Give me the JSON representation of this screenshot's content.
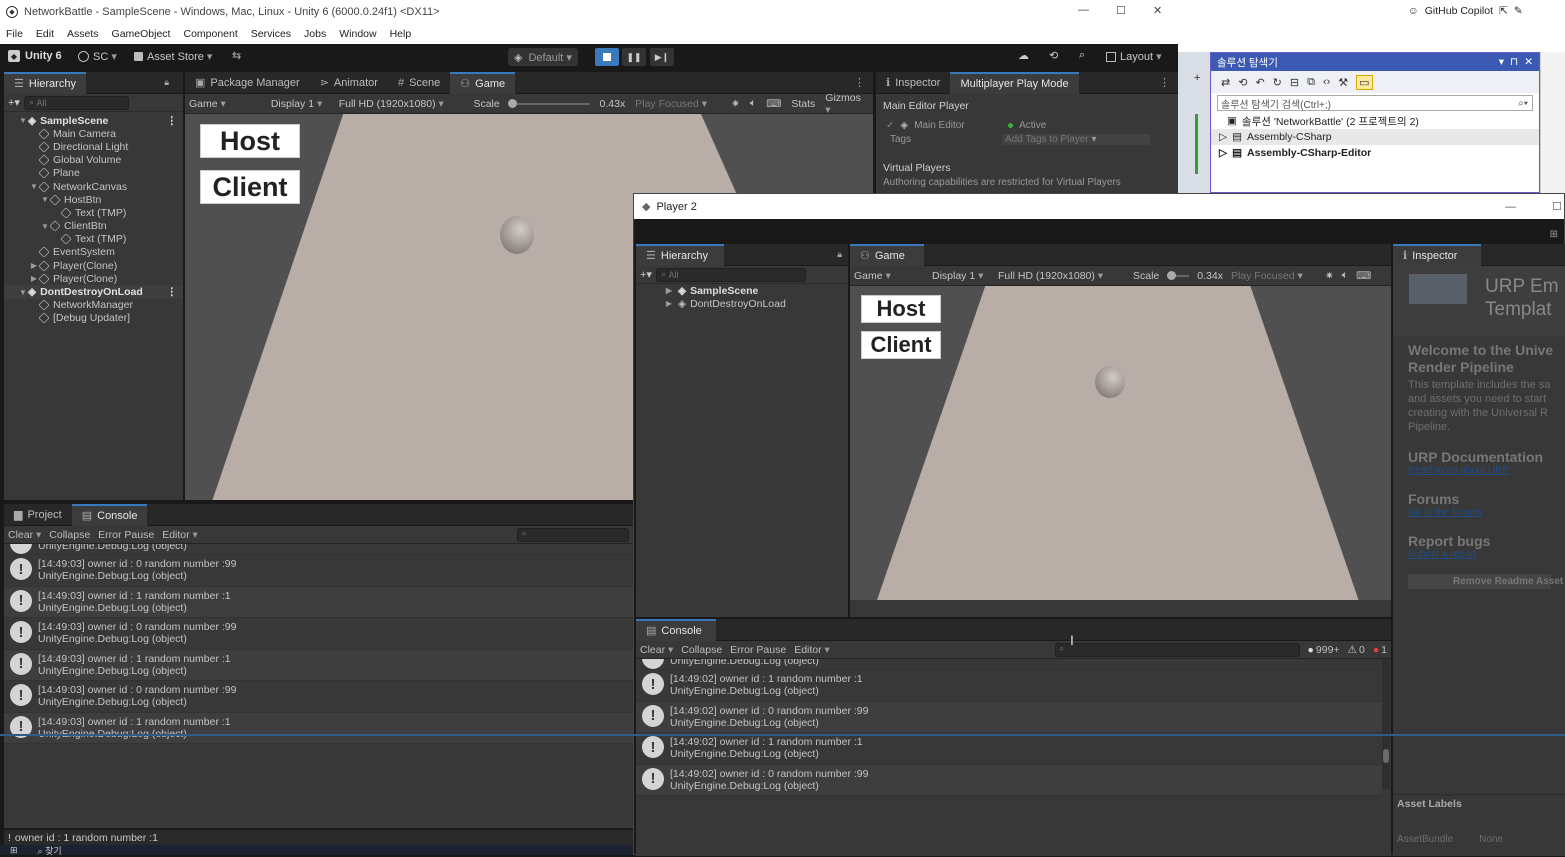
{
  "window": {
    "title": "NetworkBattle - SampleScene - Windows, Mac, Linux - Unity 6 (6000.0.24f1) <DX11>",
    "min": "—",
    "max": "☐",
    "close": "✕"
  },
  "menu": [
    "File",
    "Edit",
    "Assets",
    "GameObject",
    "Component",
    "Services",
    "Jobs",
    "Window",
    "Help"
  ],
  "toolbar": {
    "unity": "Unity 6",
    "account": "SC",
    "asset_store": "Asset Store",
    "play_default": "Default",
    "layout": "Layout"
  },
  "left_tabs": {
    "hierarchy": "Hierarchy",
    "package_manager": "Package Manager",
    "animator": "Animator",
    "scene": "Scene",
    "game": "Game"
  },
  "hierarchy_search": "All",
  "hierarchy": [
    {
      "label": "SampleScene",
      "depth": 0,
      "scene": true,
      "open": true
    },
    {
      "label": "Main Camera",
      "depth": 1
    },
    {
      "label": "Directional Light",
      "depth": 1
    },
    {
      "label": "Global Volume",
      "depth": 1
    },
    {
      "label": "Plane",
      "depth": 1
    },
    {
      "label": "NetworkCanvas",
      "depth": 1,
      "open": true
    },
    {
      "label": "HostBtn",
      "depth": 2,
      "open": true
    },
    {
      "label": "Text (TMP)",
      "depth": 3
    },
    {
      "label": "ClientBtn",
      "depth": 2,
      "open": true
    },
    {
      "label": "Text (TMP)",
      "depth": 3
    },
    {
      "label": "EventSystem",
      "depth": 1
    },
    {
      "label": "Player(Clone)",
      "depth": 1,
      "closed": true
    },
    {
      "label": "Player(Clone)",
      "depth": 1,
      "closed": true
    },
    {
      "label": "DontDestroyOnLoad",
      "depth": 0,
      "scene": true,
      "open": true
    },
    {
      "label": "NetworkManager",
      "depth": 1
    },
    {
      "label": "[Debug Updater]",
      "depth": 1
    }
  ],
  "game_toolbar": {
    "game": "Game",
    "display": "Display 1",
    "resolution": "Full HD (1920x1080)",
    "scale_label": "Scale",
    "scale_value": "0.43x",
    "play_focused": "Play Focused",
    "stats": "Stats",
    "gizmos": "Gizmos"
  },
  "game_ui": {
    "host": "Host",
    "client": "Client"
  },
  "right_tabs": {
    "inspector": "Inspector",
    "mppm": "Multiplayer Play Mode"
  },
  "mppm": {
    "heading": "Main Editor Player",
    "main_editor": "Main Editor",
    "active": "Active",
    "tags": "Tags",
    "tags_placeholder": "Add Tags to Player",
    "virtual_players": "Virtual Players",
    "virtual_note": "Authoring capabilities are restricted for Virtual Players"
  },
  "bottom_tabs": {
    "project": "Project",
    "console": "Console"
  },
  "console_bar": {
    "clear": "Clear",
    "collapse": "Collapse",
    "error_pause": "Error Pause",
    "editor": "Editor"
  },
  "console_logs": [
    {
      "line1": "[14:49:03] owner id : 0 random number :99",
      "line2": "UnityEngine.Debug:Log (object)"
    },
    {
      "line1": "[14:49:03] owner id : 1 random number :1",
      "line2": "UnityEngine.Debug:Log (object)"
    },
    {
      "line1": "[14:49:03] owner id : 0 random number :99",
      "line2": "UnityEngine.Debug:Log (object)"
    },
    {
      "line1": "[14:49:03] owner id : 1 random number :1",
      "line2": "UnityEngine.Debug:Log (object)"
    },
    {
      "line1": "[14:49:03] owner id : 0 random number :99",
      "line2": "UnityEngine.Debug:Log (object)"
    },
    {
      "line1": "[14:49:03] owner id : 1 random number :1",
      "line2": "UnityEngine.Debug:Log (object)"
    }
  ],
  "partial_log": "UnityEngine.Debug:Log (object)",
  "status_bar": "owner id : 1 random number :1",
  "vs": {
    "copilot": "GitHub Copilot",
    "explorer_title": "솔루션 탐색기",
    "search_placeholder": "솔루션 탐색기 검색(Ctrl+;)",
    "solution": "솔루션 'NetworkBattle' (2 프로젝트의 2)",
    "projects": [
      "Assembly-CSharp",
      "Assembly-CSharp-Editor"
    ]
  },
  "player2": {
    "title": "Player 2",
    "hierarchy": "Hierarchy",
    "game": "Game",
    "inspector": "Inspector",
    "search": "All",
    "scenes": [
      "SampleScene",
      "DontDestroyOnLoad"
    ],
    "game_toolbar": {
      "game": "Game",
      "display": "Display 1",
      "resolution": "Full HD (1920x1080)",
      "scale_label": "Scale",
      "scale_value": "0.34x",
      "play_focused": "Play Focused"
    },
    "console": "Console",
    "counts": {
      "logs": "999+",
      "warnings": "0",
      "errors": "1"
    },
    "partial_log": "UnityEngine.Debug:Log (object)",
    "logs": [
      {
        "line1": "[14:49:02] owner id : 1 random number :1",
        "line2": "UnityEngine.Debug:Log (object)"
      },
      {
        "line1": "[14:49:02] owner id : 0 random number :99",
        "line2": "UnityEngine.Debug:Log (object)"
      },
      {
        "line1": "[14:49:02] owner id : 1 random number :1",
        "line2": "UnityEngine.Debug:Log (object)"
      },
      {
        "line1": "[14:49:02] owner id : 0 random number :99",
        "line2": "UnityEngine.Debug:Log (object)"
      }
    ],
    "readme": {
      "title1": "URP Em",
      "title2": "Templat",
      "welcome": "Welcome to the Unive",
      "welcome2": "Render Pipeline",
      "body": "This template includes the sa and assets you need to start creating with the Universal R Pipeline.",
      "doc": "URP Documentation",
      "doc_link": "Read more about URP",
      "forums": "Forums",
      "forums_link": "Go to the forums",
      "bugs": "Report bugs",
      "bugs_link": "Submit a report",
      "remove": "Remove Readme Asset",
      "asset_labels": "Asset Labels",
      "asset_bundle": "AssetBundle",
      "none": "None"
    }
  },
  "taskbar": {
    "search": "찾기"
  }
}
